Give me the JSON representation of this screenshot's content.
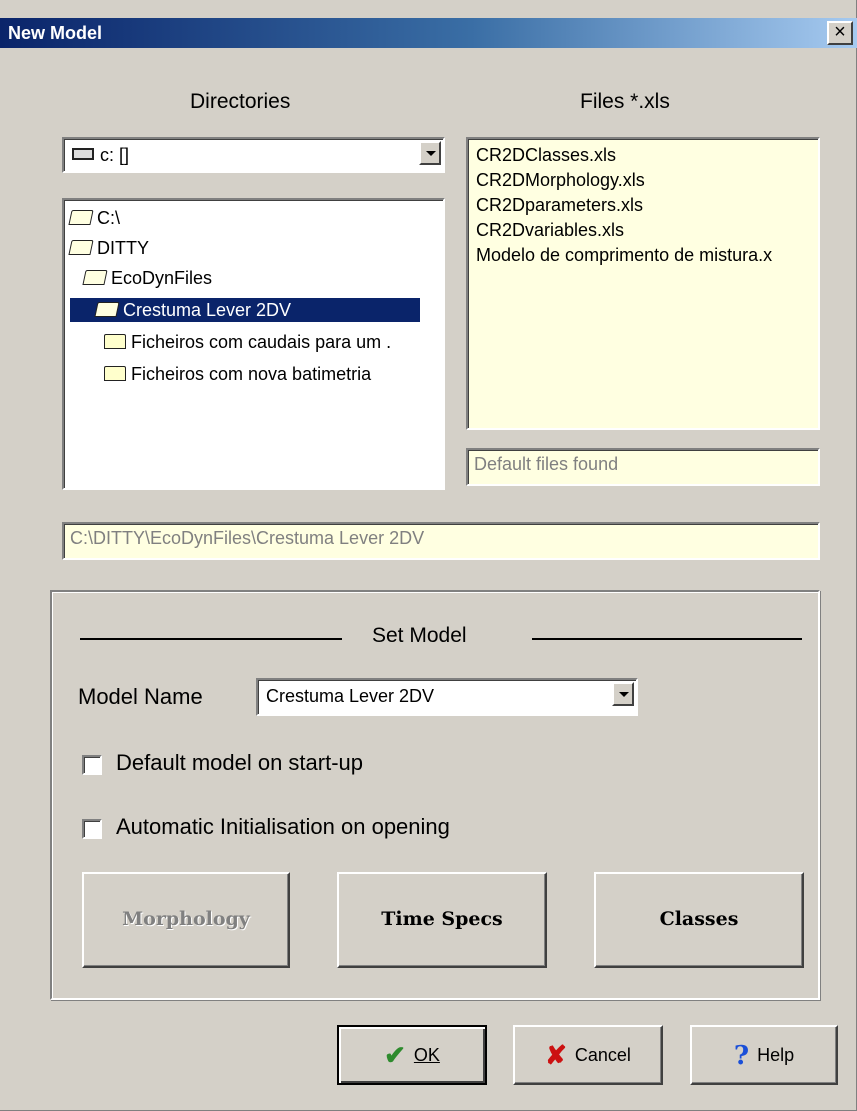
{
  "window": {
    "title": "New Model",
    "close": "×"
  },
  "directories": {
    "heading": "Directories",
    "drive": "c: []",
    "tree": [
      {
        "label": "C:\\",
        "selected": false
      },
      {
        "label": "DITTY",
        "selected": false
      },
      {
        "label": "EcoDynFiles",
        "selected": false
      },
      {
        "label": "Crestuma Lever 2DV",
        "selected": true
      },
      {
        "label": "Ficheiros com caudais para um .",
        "selected": false
      },
      {
        "label": "Ficheiros com nova batimetria",
        "selected": false
      }
    ]
  },
  "files": {
    "heading": "Files *.xls",
    "items": [
      "CR2DClasses.xls",
      "CR2DMorphology.xls",
      "CR2Dparameters.xls",
      "CR2Dvariables.xls",
      "Modelo de comprimento de mistura.x"
    ],
    "status": "Default files found"
  },
  "path": "C:\\DITTY\\EcoDynFiles\\Crestuma Lever 2DV",
  "set_model": {
    "heading": "Set Model",
    "model_name_label": "Model Name",
    "model_name_value": "Crestuma Lever 2DV",
    "default_on_startup": "Default model on start-up",
    "auto_init": "Automatic Initialisation on opening",
    "buttons": {
      "morphology": "Morphology",
      "time_specs": "Time Specs",
      "classes": "Classes"
    }
  },
  "dialog_buttons": {
    "ok": "OK",
    "cancel": "Cancel",
    "help": "Help"
  }
}
